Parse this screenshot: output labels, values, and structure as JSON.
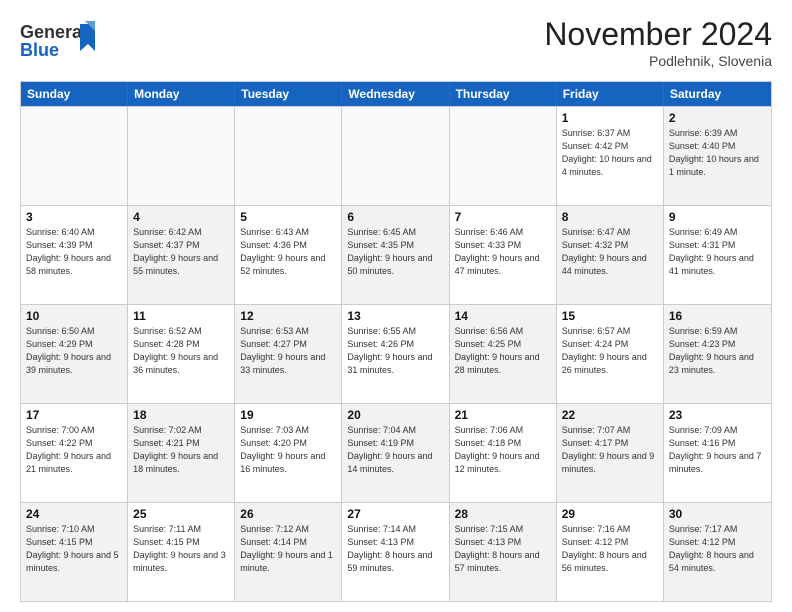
{
  "header": {
    "logo_general": "General",
    "logo_blue": "Blue",
    "month_title": "November 2024",
    "location": "Podlehnik, Slovenia"
  },
  "weekdays": [
    "Sunday",
    "Monday",
    "Tuesday",
    "Wednesday",
    "Thursday",
    "Friday",
    "Saturday"
  ],
  "rows": [
    [
      {
        "day": "",
        "info": "",
        "empty": true
      },
      {
        "day": "",
        "info": "",
        "empty": true
      },
      {
        "day": "",
        "info": "",
        "empty": true
      },
      {
        "day": "",
        "info": "",
        "empty": true
      },
      {
        "day": "",
        "info": "",
        "empty": true
      },
      {
        "day": "1",
        "info": "Sunrise: 6:37 AM\nSunset: 4:42 PM\nDaylight: 10 hours\nand 4 minutes.",
        "empty": false
      },
      {
        "day": "2",
        "info": "Sunrise: 6:39 AM\nSunset: 4:40 PM\nDaylight: 10 hours\nand 1 minute.",
        "empty": false,
        "alt": true
      }
    ],
    [
      {
        "day": "3",
        "info": "Sunrise: 6:40 AM\nSunset: 4:39 PM\nDaylight: 9 hours\nand 58 minutes.",
        "empty": false
      },
      {
        "day": "4",
        "info": "Sunrise: 6:42 AM\nSunset: 4:37 PM\nDaylight: 9 hours\nand 55 minutes.",
        "empty": false,
        "alt": true
      },
      {
        "day": "5",
        "info": "Sunrise: 6:43 AM\nSunset: 4:36 PM\nDaylight: 9 hours\nand 52 minutes.",
        "empty": false
      },
      {
        "day": "6",
        "info": "Sunrise: 6:45 AM\nSunset: 4:35 PM\nDaylight: 9 hours\nand 50 minutes.",
        "empty": false,
        "alt": true
      },
      {
        "day": "7",
        "info": "Sunrise: 6:46 AM\nSunset: 4:33 PM\nDaylight: 9 hours\nand 47 minutes.",
        "empty": false
      },
      {
        "day": "8",
        "info": "Sunrise: 6:47 AM\nSunset: 4:32 PM\nDaylight: 9 hours\nand 44 minutes.",
        "empty": false,
        "alt": true
      },
      {
        "day": "9",
        "info": "Sunrise: 6:49 AM\nSunset: 4:31 PM\nDaylight: 9 hours\nand 41 minutes.",
        "empty": false
      }
    ],
    [
      {
        "day": "10",
        "info": "Sunrise: 6:50 AM\nSunset: 4:29 PM\nDaylight: 9 hours\nand 39 minutes.",
        "empty": false,
        "alt": true
      },
      {
        "day": "11",
        "info": "Sunrise: 6:52 AM\nSunset: 4:28 PM\nDaylight: 9 hours\nand 36 minutes.",
        "empty": false
      },
      {
        "day": "12",
        "info": "Sunrise: 6:53 AM\nSunset: 4:27 PM\nDaylight: 9 hours\nand 33 minutes.",
        "empty": false,
        "alt": true
      },
      {
        "day": "13",
        "info": "Sunrise: 6:55 AM\nSunset: 4:26 PM\nDaylight: 9 hours\nand 31 minutes.",
        "empty": false
      },
      {
        "day": "14",
        "info": "Sunrise: 6:56 AM\nSunset: 4:25 PM\nDaylight: 9 hours\nand 28 minutes.",
        "empty": false,
        "alt": true
      },
      {
        "day": "15",
        "info": "Sunrise: 6:57 AM\nSunset: 4:24 PM\nDaylight: 9 hours\nand 26 minutes.",
        "empty": false
      },
      {
        "day": "16",
        "info": "Sunrise: 6:59 AM\nSunset: 4:23 PM\nDaylight: 9 hours\nand 23 minutes.",
        "empty": false,
        "alt": true
      }
    ],
    [
      {
        "day": "17",
        "info": "Sunrise: 7:00 AM\nSunset: 4:22 PM\nDaylight: 9 hours\nand 21 minutes.",
        "empty": false
      },
      {
        "day": "18",
        "info": "Sunrise: 7:02 AM\nSunset: 4:21 PM\nDaylight: 9 hours\nand 18 minutes.",
        "empty": false,
        "alt": true
      },
      {
        "day": "19",
        "info": "Sunrise: 7:03 AM\nSunset: 4:20 PM\nDaylight: 9 hours\nand 16 minutes.",
        "empty": false
      },
      {
        "day": "20",
        "info": "Sunrise: 7:04 AM\nSunset: 4:19 PM\nDaylight: 9 hours\nand 14 minutes.",
        "empty": false,
        "alt": true
      },
      {
        "day": "21",
        "info": "Sunrise: 7:06 AM\nSunset: 4:18 PM\nDaylight: 9 hours\nand 12 minutes.",
        "empty": false
      },
      {
        "day": "22",
        "info": "Sunrise: 7:07 AM\nSunset: 4:17 PM\nDaylight: 9 hours\nand 9 minutes.",
        "empty": false,
        "alt": true
      },
      {
        "day": "23",
        "info": "Sunrise: 7:09 AM\nSunset: 4:16 PM\nDaylight: 9 hours\nand 7 minutes.",
        "empty": false
      }
    ],
    [
      {
        "day": "24",
        "info": "Sunrise: 7:10 AM\nSunset: 4:15 PM\nDaylight: 9 hours\nand 5 minutes.",
        "empty": false,
        "alt": true
      },
      {
        "day": "25",
        "info": "Sunrise: 7:11 AM\nSunset: 4:15 PM\nDaylight: 9 hours\nand 3 minutes.",
        "empty": false
      },
      {
        "day": "26",
        "info": "Sunrise: 7:12 AM\nSunset: 4:14 PM\nDaylight: 9 hours\nand 1 minute.",
        "empty": false,
        "alt": true
      },
      {
        "day": "27",
        "info": "Sunrise: 7:14 AM\nSunset: 4:13 PM\nDaylight: 8 hours\nand 59 minutes.",
        "empty": false
      },
      {
        "day": "28",
        "info": "Sunrise: 7:15 AM\nSunset: 4:13 PM\nDaylight: 8 hours\nand 57 minutes.",
        "empty": false,
        "alt": true
      },
      {
        "day": "29",
        "info": "Sunrise: 7:16 AM\nSunset: 4:12 PM\nDaylight: 8 hours\nand 56 minutes.",
        "empty": false
      },
      {
        "day": "30",
        "info": "Sunrise: 7:17 AM\nSunset: 4:12 PM\nDaylight: 8 hours\nand 54 minutes.",
        "empty": false,
        "alt": true
      }
    ]
  ]
}
